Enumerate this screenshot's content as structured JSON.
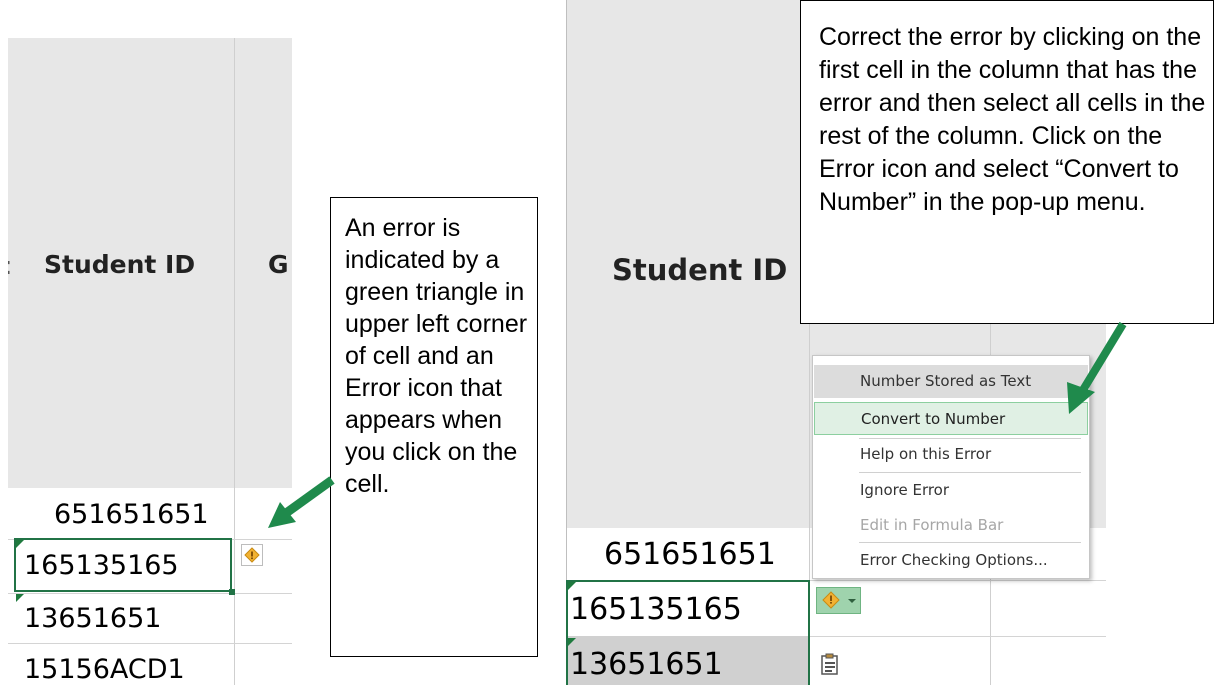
{
  "left": {
    "header_label": "Student ID",
    "next_col_letter": "G",
    "left_fragment": ":",
    "rows": [
      "651651651",
      "165135165",
      "13651651",
      "15156ACD1"
    ],
    "callout_text": "An error is indicated by a green triangle in upper left corner of cell and an Error icon that appears when you click on the cell."
  },
  "right": {
    "header_label": "Student ID",
    "rows": [
      "651651651",
      "165135165",
      "13651651"
    ],
    "callout_text": "Correct the error by clicking on the first cell in the column that has the error and then select all cells in the rest of the column. Click on the Error icon and select “Convert to Number” in the pop-up menu.",
    "menu": {
      "title": "Number Stored as Text",
      "items": [
        "Convert to Number",
        "Help on this Error",
        "Ignore Error",
        "Edit in Formula Bar",
        "Error Checking Options..."
      ]
    }
  },
  "colors": {
    "arrow": "#1f8a4c",
    "error_triangle": "#1f7a3e",
    "selected_border": "#217346",
    "highlight_item": "#e0f0e4",
    "header_bg": "#e7e7e7"
  },
  "icons": [
    "error-warning-icon",
    "dropdown-chevron-icon",
    "paste-options-icon",
    "arrow-icon"
  ]
}
